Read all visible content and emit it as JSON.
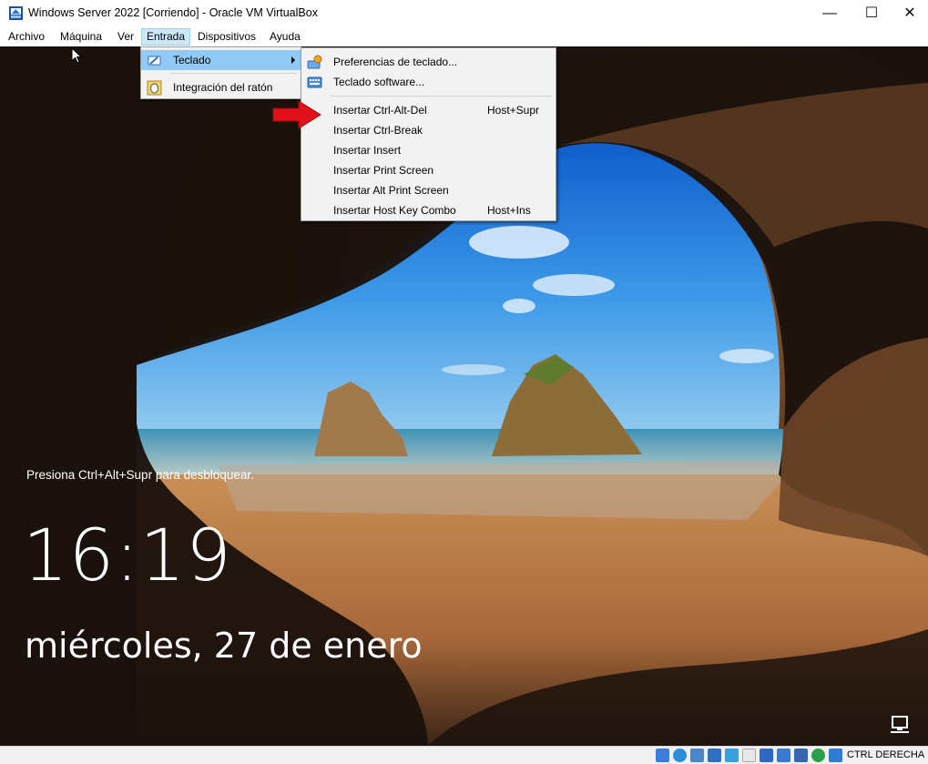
{
  "window": {
    "title": "Windows Server 2022 [Corriendo] - Oracle VM VirtualBox",
    "controls": {
      "minimize": "—",
      "maximize": "☐",
      "close": "✕"
    }
  },
  "menubar": {
    "items": [
      {
        "label": "Archivo"
      },
      {
        "label": "Máquina"
      },
      {
        "label": "Ver"
      },
      {
        "label": "Entrada"
      },
      {
        "label": "Dispositivos"
      },
      {
        "label": "Ayuda"
      }
    ],
    "active": "Entrada"
  },
  "entrada_menu": {
    "items": [
      {
        "label": "Teclado",
        "has_submenu": true,
        "icon": "keyboard-pen-icon"
      },
      {
        "label": "Integración del ratón",
        "icon": "mouse-integration-icon"
      }
    ]
  },
  "teclado_submenu": {
    "items": [
      {
        "label": "Preferencias de teclado...",
        "shortcut": "",
        "icon": "keyboard-settings-icon"
      },
      {
        "label": "Teclado software...",
        "shortcut": "",
        "icon": "soft-keyboard-icon"
      },
      {
        "label": "Insertar Ctrl-Alt-Del",
        "shortcut": "Host+Supr"
      },
      {
        "label": "Insertar Ctrl-Break",
        "shortcut": ""
      },
      {
        "label": "Insertar Insert",
        "shortcut": ""
      },
      {
        "label": "Insertar Print Screen",
        "shortcut": ""
      },
      {
        "label": "Insertar Alt Print Screen",
        "shortcut": ""
      },
      {
        "label": "Insertar Host Key Combo",
        "shortcut": "Host+Ins"
      }
    ]
  },
  "lock_screen": {
    "hint": "Presiona Ctrl+Alt+Supr para desbloquear.",
    "time": "16:19",
    "date": "miércoles, 27 de enero"
  },
  "statusbar": {
    "host_key": "CTRL DERECHA",
    "icons": [
      "hard-disk-icon",
      "optical-drive-icon",
      "audio-icon",
      "network-icon",
      "usb-icon",
      "shared-folder-icon",
      "display-icon",
      "recording-icon",
      "cpu-icon",
      "mouse-integration-icon",
      "keyboard-capture-icon"
    ]
  },
  "colors": {
    "menu_highlight": "#91c9f7",
    "menubar_active": "#cce8ff",
    "annotation_arrow": "#e0111b"
  }
}
